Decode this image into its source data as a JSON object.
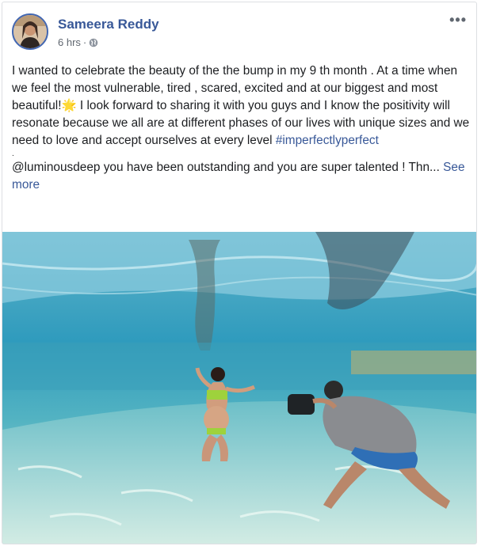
{
  "post": {
    "author": "Sameera Reddy",
    "time": "6 hrs",
    "dot": "·",
    "more_label": "•••",
    "body_line_1": "I wanted to celebrate the beauty of the the bump in my 9 th month . At a time when we feel the most vulnerable, tired , scared, excited and at our biggest and most beautiful!",
    "emoji": "🌟",
    "body_line_2": " I look forward to sharing it with you guys and I know the positivity will resonate because we all are at different phases of our lives with unique sizes and we need to love and accept ourselves at every level",
    "hashtag": "#imperfectlyperfect",
    "period": ".",
    "body_line_3": "@luminousdeep you have been outstanding and you are super talented ! Thn...",
    "see_more": "See more",
    "icons": {
      "privacy": "globe-icon",
      "options": "more-options-icon"
    },
    "colors": {
      "name": "#385898",
      "link": "#385898",
      "meta": "#606770",
      "water": "#3aa6c4"
    }
  }
}
